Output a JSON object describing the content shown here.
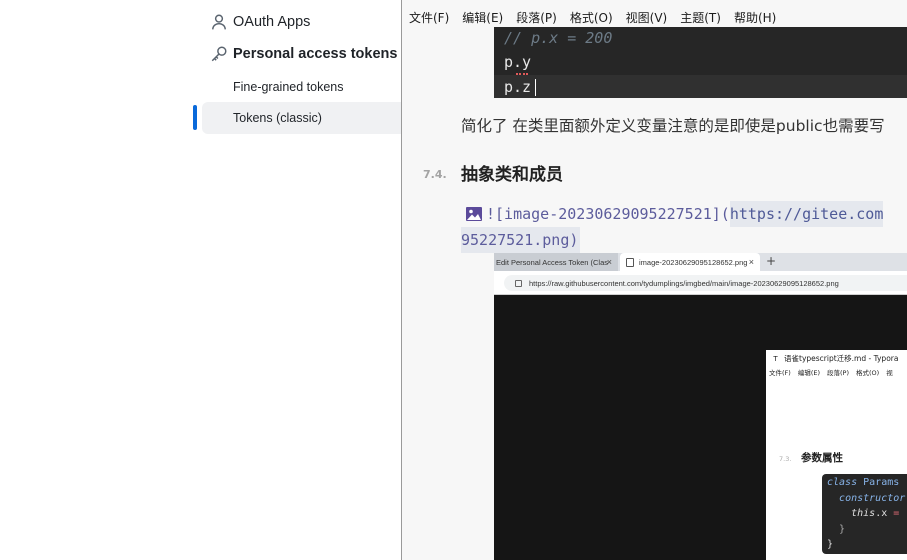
{
  "github_sidebar": {
    "oauth_apps": "OAuth Apps",
    "personal_access_tokens": "Personal access tokens",
    "fine_grained_tokens": "Fine-grained tokens",
    "tokens_classic": "Tokens (classic)",
    "accent_color": "#0969da"
  },
  "typora": {
    "menu": [
      "文件(F)",
      "编辑(E)",
      "段落(P)",
      "格式(O)",
      "视图(V)",
      "主题(T)",
      "帮助(H)"
    ],
    "code_block": {
      "line1": "// p.x = 200",
      "line2": "p.y",
      "line3": "p.z"
    },
    "paragraph": "简化了 在类里面额外定义变量注意的是即使是public也需要写",
    "heading_number": "7.4.",
    "heading_title": "抽象类和成员",
    "image_markdown_prefix": "![image-20230629095227521](",
    "image_markdown_link": "https://gitee.com",
    "image_markdown_line2": "95227521.png)"
  },
  "embedded_screenshot": {
    "tab1_title": "Edit Personal Access Token (Clas",
    "tab2_title": "image-20230629095128652.png",
    "new_tab_symbol": "+",
    "close_symbol": "×",
    "address": "https://raw.githubusercontent.com/tydumplings/imgbed/main/image-20230629095128652.png",
    "inner_window": {
      "title_icon": "T",
      "title": "语雀typescript迁移.md - Typora",
      "menu": [
        "文件(F)",
        "编辑(E)",
        "段落(P)",
        "格式(O)",
        "视"
      ],
      "heading_number": "7.3.",
      "heading_title": "参数属性",
      "code": {
        "line1_kw": "class",
        "line1_name": "Params",
        "line2": "constructor",
        "line3_kw": "this",
        "line3_rest": ".x",
        "line3_op": "=",
        "line4": "}",
        "line5": "}"
      }
    }
  }
}
